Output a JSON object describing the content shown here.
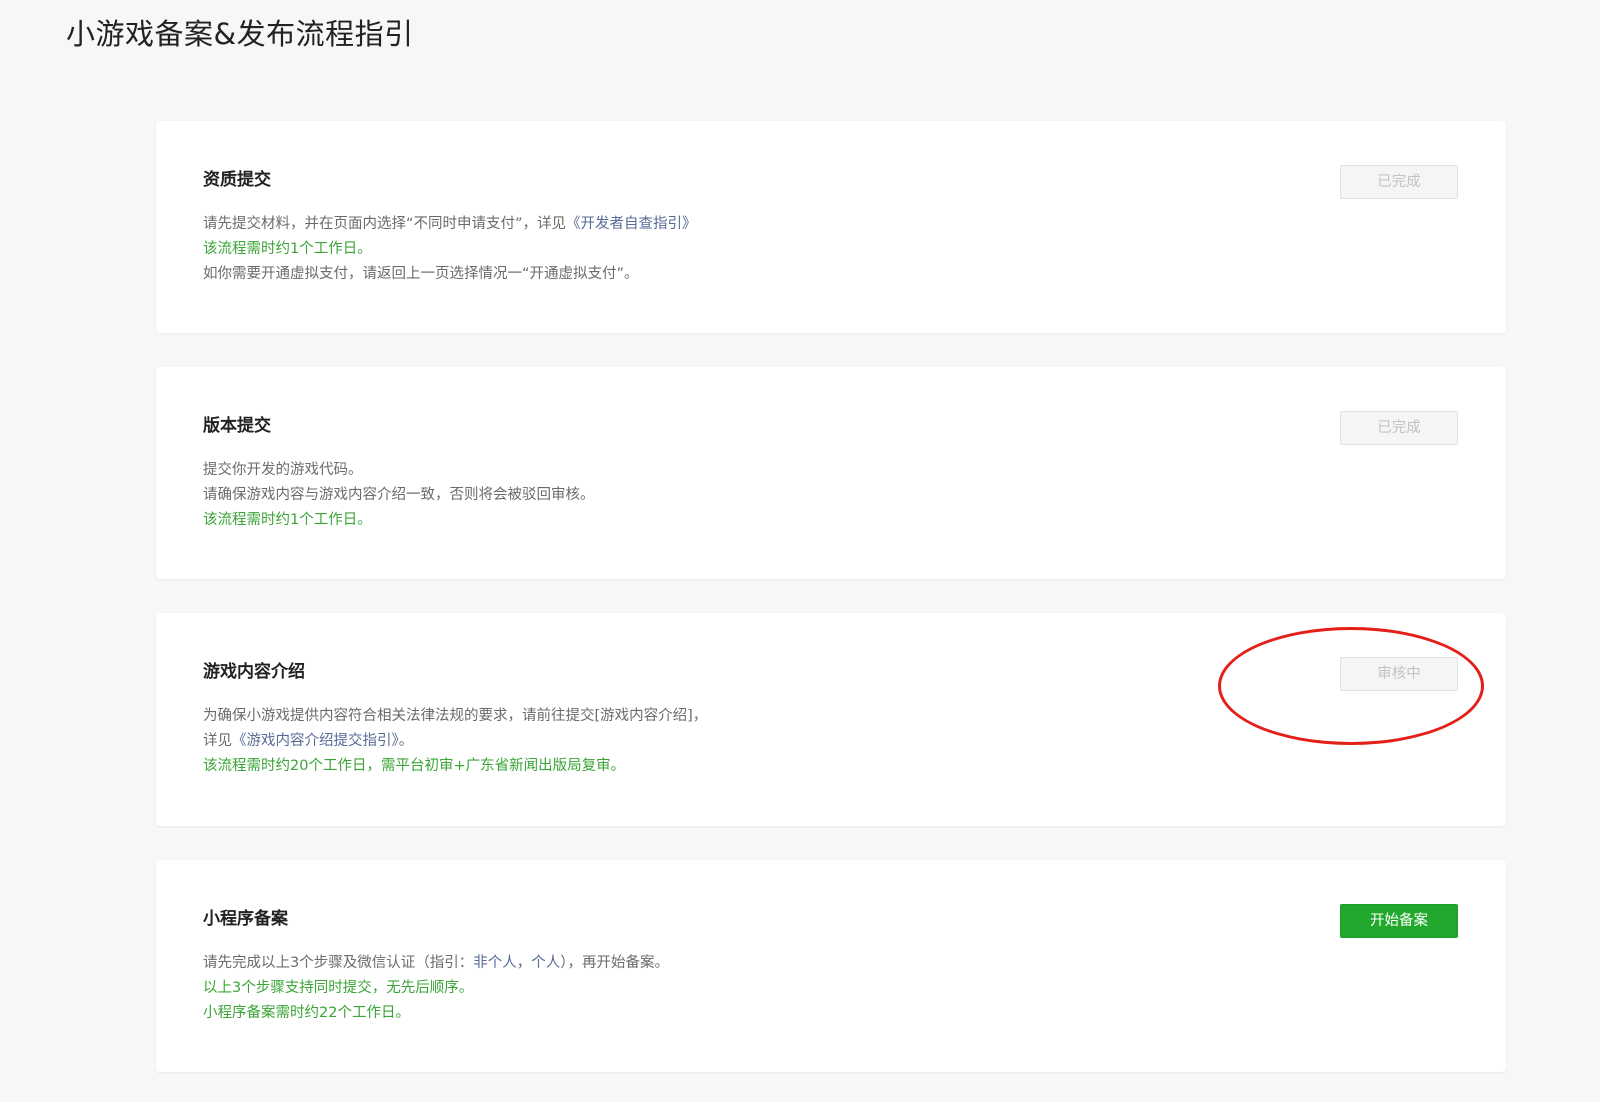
{
  "page": {
    "title": "小游戏备案&发布流程指引"
  },
  "cards": [
    {
      "title": "资质提交",
      "button_label": "已完成",
      "button_state": "disabled",
      "line1_prefix": "请先提交材料，并在页面内选择“不同时申请支付”，详见",
      "line1_link": "《开发者自查指引》",
      "line2": "该流程需时约1个工作日。",
      "line3": "如你需要开通虚拟支付，请返回上一页选择情况一“开通虚拟支付”。"
    },
    {
      "title": "版本提交",
      "button_label": "已完成",
      "button_state": "disabled",
      "line1": "提交你开发的游戏代码。",
      "line2": "请确保游戏内容与游戏内容介绍一致，否则将会被驳回审核。",
      "line3": "该流程需时约1个工作日。"
    },
    {
      "title": "游戏内容介绍",
      "button_label": "审核中",
      "button_state": "disabled",
      "line1": "为确保小游戏提供内容符合相关法律法规的要求，请前往提交[游戏内容介绍]，",
      "line2_prefix": "详见",
      "line2_link": "《游戏内容介绍提交指引》",
      "line2_suffix": "。",
      "line3": "该流程需时约20个工作日，需平台初审+广东省新闻出版局复审。"
    },
    {
      "title": "小程序备案",
      "button_label": "开始备案",
      "button_state": "primary",
      "line1_prefix": "请先完成以上3个步骤及微信认证（指引：",
      "line1_link1": "非个人",
      "line1_sep": "，",
      "line1_link2": "个人",
      "line1_suffix": "），再开始备案。",
      "line2": "以上3个步骤支持同时提交，无先后顺序。",
      "line3": "小程序备案需时约22个工作日。"
    }
  ],
  "colors": {
    "page_background": "#f6f7f8",
    "card_background": "#ffffff",
    "green_note": "#3aa536",
    "link": "#576b95",
    "primary_button": "#22a82c",
    "annotation_circle": "#e41f18"
  }
}
